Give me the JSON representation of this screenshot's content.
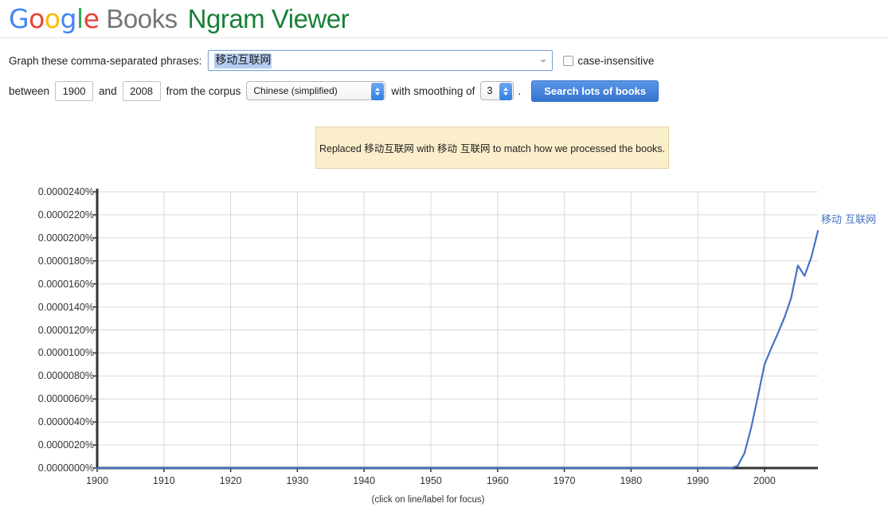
{
  "header": {
    "logo_google": [
      "G",
      "o",
      "o",
      "g",
      "l",
      "e"
    ],
    "logo_books": "Books",
    "logo_ngram": "Ngram Viewer"
  },
  "query": {
    "label": "Graph these comma-separated phrases:",
    "phrase_value": "移动互联网",
    "dropdown_icon": "chevron-down-icon",
    "case_insensitive_label": "case-insensitive",
    "case_insensitive_checked": false
  },
  "params": {
    "between_label": "between",
    "year_start": "1900",
    "and_label": "and",
    "year_end": "2008",
    "corpus_label": "from the corpus",
    "corpus_value": "Chinese (simplified)",
    "smoothing_label": "with smoothing of",
    "smoothing_value": "3",
    "period": ".",
    "search_button": "Search lots of books"
  },
  "notice": {
    "prefix": "Replaced ",
    "original": "移动互联网",
    "middle": " with ",
    "replacement": "移动 互联网",
    "suffix": " to match how we processed the books."
  },
  "chart_footnote": "(click on line/label for focus)",
  "colors": {
    "series_blue": "#4472c4",
    "axis_dark": "#333333",
    "gridline": "#d9d9d9",
    "accent_blue": "#3573cf",
    "notice_bg": "#fbeecb",
    "google_blue": "#4285F4",
    "google_red": "#EA4335",
    "google_yellow": "#FBBC05",
    "google_green": "#34A853",
    "books_gray": "#757575",
    "ngram_green": "#188038"
  },
  "chart_data": {
    "type": "line",
    "title": "",
    "xlabel": "",
    "ylabel": "",
    "grid": true,
    "legend_position": "right-inline",
    "xlim": [
      1900,
      2008
    ],
    "ylim": [
      0.0,
      2.4e-05
    ],
    "xticks": [
      1900,
      1910,
      1920,
      1930,
      1940,
      1950,
      1960,
      1970,
      1980,
      1990,
      2000
    ],
    "yticks": [
      0.0,
      2e-06,
      4e-06,
      6e-06,
      8e-06,
      1e-05,
      1.2e-05,
      1.4e-05,
      1.6e-05,
      1.8e-05,
      2e-05,
      2.2e-05,
      2.4e-05
    ],
    "ytick_labels": [
      "0.0000000%",
      "0.0000020%",
      "0.0000040%",
      "0.0000060%",
      "0.0000080%",
      "0.0000100%",
      "0.0000120%",
      "0.0000140%",
      "0.0000160%",
      "0.0000180%",
      "0.0000200%",
      "0.0000220%",
      "0.0000240%"
    ],
    "xtick_labels": [
      "1900",
      "1910",
      "1920",
      "1930",
      "1940",
      "1950",
      "1960",
      "1970",
      "1980",
      "1990",
      "2000"
    ],
    "series": [
      {
        "name": "移动 互联网",
        "color": "#4472c4",
        "x": [
          1900,
          1910,
          1920,
          1930,
          1940,
          1950,
          1960,
          1970,
          1980,
          1985,
          1990,
          1992,
          1994,
          1995,
          1996,
          1997,
          1998,
          1999,
          2000,
          2001,
          2002,
          2003,
          2004,
          2005,
          2006,
          2007,
          2008
        ],
        "values": [
          0,
          0,
          0,
          0,
          0,
          0,
          0,
          0,
          0,
          0,
          0,
          0,
          0,
          0,
          2e-07,
          1.3e-06,
          3.5e-06,
          6.2e-06,
          9e-06,
          1.04e-05,
          1.17e-05,
          1.31e-05,
          1.48e-05,
          1.76e-05,
          1.67e-05,
          1.83e-05,
          2.06e-05
        ]
      }
    ]
  }
}
